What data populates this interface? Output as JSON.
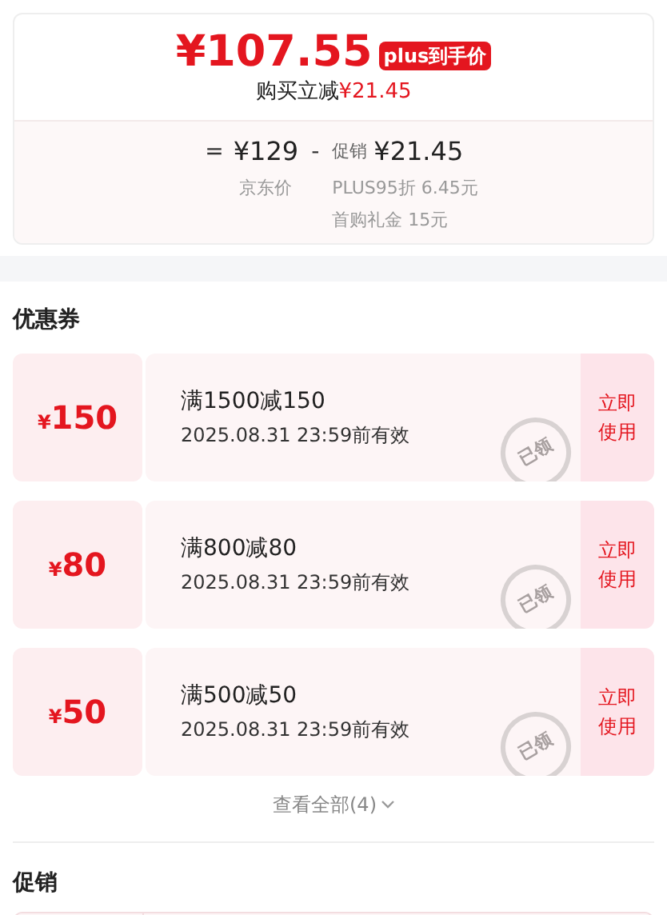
{
  "price_card": {
    "price": "¥107.55",
    "badge": "plus到手价",
    "saving_label": "购买立减",
    "saving_value": "¥21.45",
    "breakdown": {
      "equals": "=",
      "base_price": "¥129",
      "base_label": "京东价",
      "minus": "-",
      "promo_label": "促销",
      "promo_value": "¥21.45",
      "details": [
        "PLUS95折 6.45元",
        "首购礼金 15元"
      ]
    }
  },
  "coupons": {
    "title": "优惠券",
    "items": [
      {
        "amount_symbol": "¥",
        "amount": "150",
        "condition": "满1500减150",
        "validity": "2025.08.31 23:59前有效",
        "stamp": "已领",
        "action": "立即使用"
      },
      {
        "amount_symbol": "¥",
        "amount": "80",
        "condition": "满800减80",
        "validity": "2025.08.31 23:59前有效",
        "stamp": "已领",
        "action": "立即使用"
      },
      {
        "amount_symbol": "¥",
        "amount": "50",
        "condition": "满500减50",
        "validity": "2025.08.31 23:59前有效",
        "stamp": "已领",
        "action": "立即使用"
      }
    ],
    "view_all": "查看全部(4)"
  },
  "promotions": {
    "title": "促销"
  }
}
